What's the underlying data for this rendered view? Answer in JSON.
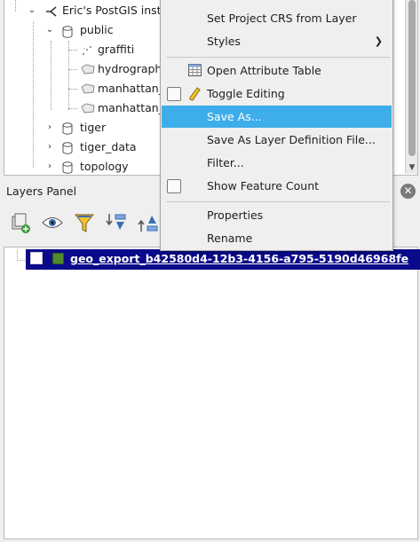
{
  "browser": {
    "connection_label": "Eric's PostGIS insta",
    "schemas": [
      {
        "label": "public",
        "expanded": true
      },
      {
        "label": "tiger",
        "expanded": false
      },
      {
        "label": "tiger_data",
        "expanded": false
      },
      {
        "label": "topology",
        "expanded": false
      }
    ],
    "public_items": [
      {
        "label": "graffiti",
        "icon": "point-layer-icon"
      },
      {
        "label": "hydrograph",
        "icon": "polygon-layer-icon"
      },
      {
        "label": "manhattan_",
        "icon": "polygon-layer-icon"
      },
      {
        "label": "manhattan_",
        "icon": "polygon-layer-icon"
      }
    ]
  },
  "context_menu": {
    "items": [
      {
        "id": "set-crs",
        "label": "Set Project CRS from Layer",
        "accel": "P"
      },
      {
        "id": "styles",
        "label": "Styles",
        "has_submenu": true
      },
      {
        "id": "open-attr",
        "label": "Open Attribute Table",
        "accel": "O"
      },
      {
        "id": "toggle-edit",
        "label": "Toggle Editing",
        "checkable": true,
        "checked": false
      },
      {
        "id": "save-as",
        "label": "Save As...",
        "highlighted": true
      },
      {
        "id": "save-def",
        "label": "Save As Layer Definition File..."
      },
      {
        "id": "filter",
        "label": "Filter...",
        "accel": "F"
      },
      {
        "id": "show-count",
        "label": "Show Feature Count",
        "checkable": true,
        "checked": false
      },
      {
        "id": "properties",
        "label": "Properties",
        "accel": "P"
      },
      {
        "id": "rename",
        "label": "Rename",
        "accel": "n"
      }
    ],
    "highlight_color": "#3daee9"
  },
  "layers_panel": {
    "title": "Layers Panel",
    "toolbar_icons": [
      "add-group-icon",
      "visibility-eye-icon",
      "filter-funnel-icon",
      "expand-all-icon",
      "collapse-all-icon"
    ],
    "layer": {
      "name": "geo_export_b42580d4-12b3-4156-a795-5190d46968fe",
      "checked": false,
      "swatch_color": "#4f8a2e",
      "selected_bg": "#0a0a8a"
    }
  }
}
